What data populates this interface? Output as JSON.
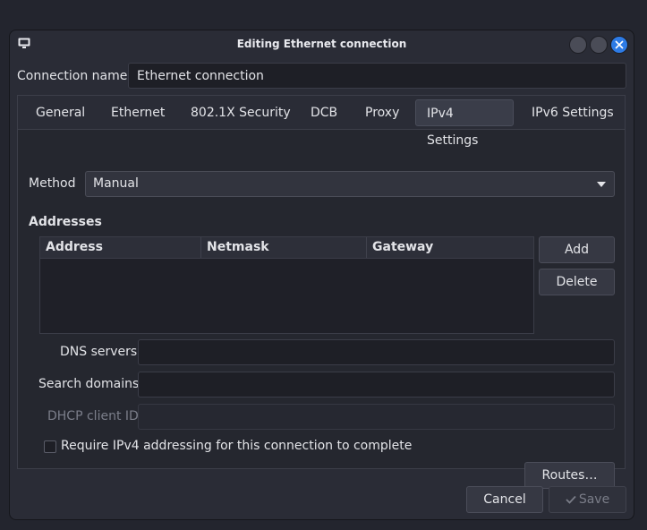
{
  "window": {
    "title": "Editing Ethernet connection",
    "icon": "monitor-icon"
  },
  "connection": {
    "label": "Connection name",
    "value": "Ethernet connection"
  },
  "tabs": [
    {
      "label": "General"
    },
    {
      "label": "Ethernet"
    },
    {
      "label": "802.1X Security"
    },
    {
      "label": "DCB"
    },
    {
      "label": "Proxy"
    },
    {
      "label": "IPv4 Settings"
    },
    {
      "label": "IPv6 Settings"
    }
  ],
  "active_tab": "IPv4 Settings",
  "ipv4": {
    "method_label": "Method",
    "method_value": "Manual",
    "addresses_heading": "Addresses",
    "columns": [
      "Address",
      "Netmask",
      "Gateway"
    ],
    "rows": [],
    "add_label": "Add",
    "delete_label": "Delete",
    "dns_label": "DNS servers",
    "dns_value": "",
    "search_label": "Search domains",
    "search_value": "",
    "dhcp_label": "DHCP client ID",
    "dhcp_value": "",
    "require_label": "Require IPv4 addressing for this connection to complete",
    "require_checked": false,
    "routes_label": "Routes…"
  },
  "footer": {
    "cancel_label": "Cancel",
    "save_label": "Save"
  },
  "colors": {
    "window_bg": "#2a2c36",
    "close_button": "#2d7be6"
  }
}
